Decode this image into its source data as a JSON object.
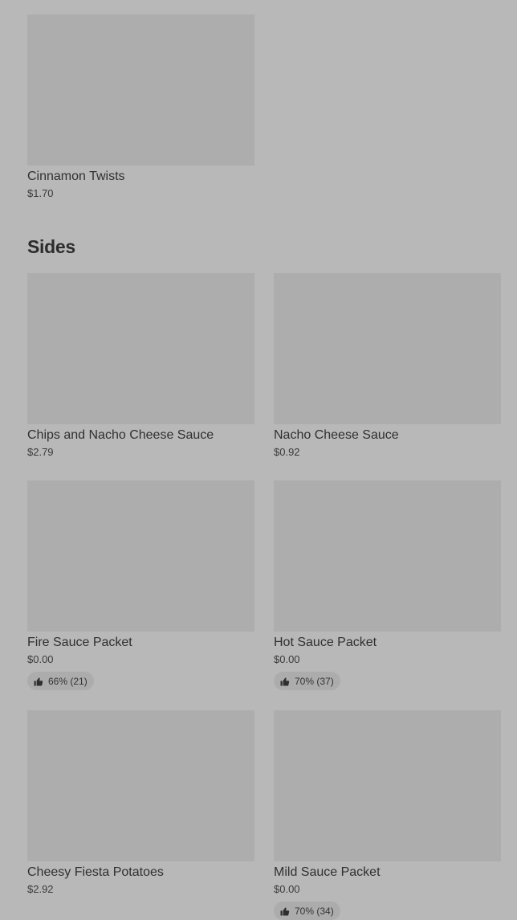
{
  "top_items": [
    {
      "name": "Cinnamon Twists",
      "price": "$1.70"
    }
  ],
  "sides": {
    "title": "Sides",
    "items": [
      {
        "name": "Chips and Nacho Cheese Sauce",
        "price": "$2.79"
      },
      {
        "name": "Nacho Cheese Sauce",
        "price": "$0.92"
      },
      {
        "name": "Fire Sauce Packet",
        "price": "$0.00",
        "rating": "66% (21)"
      },
      {
        "name": "Hot Sauce Packet",
        "price": "$0.00",
        "rating": "70% (37)"
      },
      {
        "name": "Cheesy Fiesta Potatoes",
        "price": "$2.92"
      },
      {
        "name": "Mild Sauce Packet",
        "price": "$0.00",
        "rating": "70% (34)"
      }
    ]
  },
  "icons": {
    "rating": "thumbs-up-icon"
  }
}
